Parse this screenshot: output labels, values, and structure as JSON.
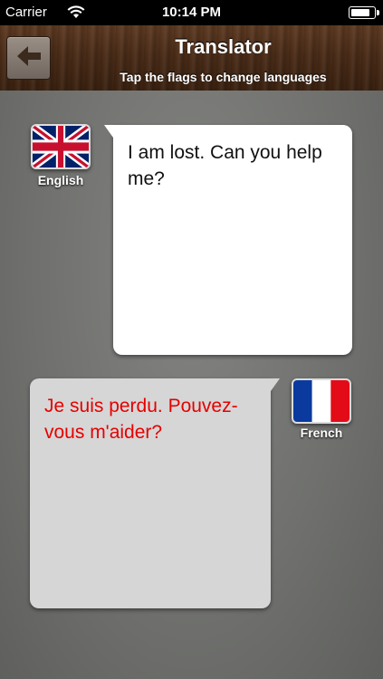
{
  "status_bar": {
    "carrier": "Carrier",
    "time": "10:14 PM",
    "battery_level": 0.92
  },
  "header": {
    "title": "Translator",
    "subtitle": "Tap the flags to change languages",
    "back_icon": "arrow-left-icon"
  },
  "source": {
    "language": "English",
    "flag_icon": "uk-flag-icon",
    "text": "I am lost. Can you help me?",
    "text_color": "#111111"
  },
  "target": {
    "language": "French",
    "flag_icon": "france-flag-icon",
    "text": "Je suis perdu. Pouvez-vous m'aider?",
    "text_color": "#e60000"
  }
}
